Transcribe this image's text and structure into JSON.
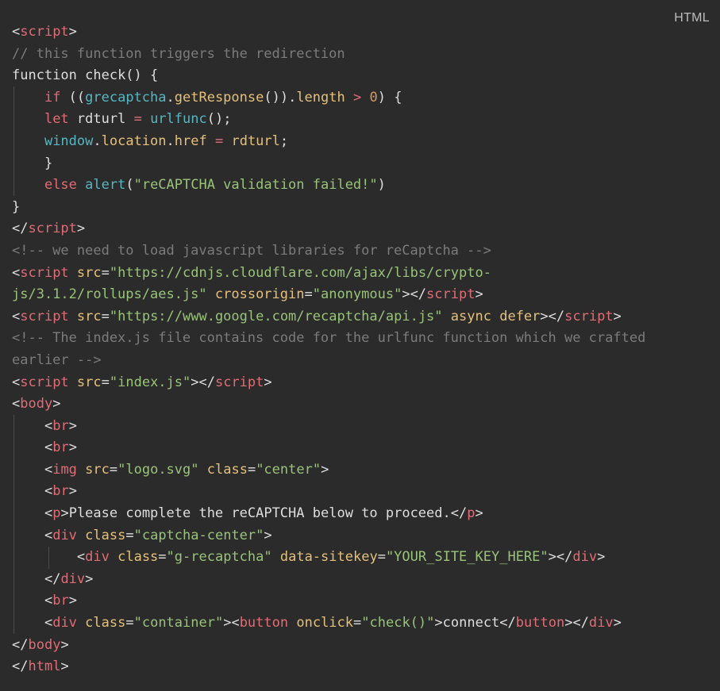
{
  "header": {
    "language_label": "HTML"
  },
  "code_lines": [
    [
      [
        "tag-bracket",
        "<"
      ],
      [
        "tag",
        "script"
      ],
      [
        "tag-bracket",
        ">"
      ]
    ],
    [
      [
        "comment",
        "// this function triggers the redirection"
      ]
    ],
    [
      [
        "plain",
        "function "
      ],
      [
        "plain",
        "check() {"
      ]
    ],
    [
      [
        "plain",
        "    "
      ],
      [
        "kw",
        "if"
      ],
      [
        "plain",
        " (("
      ],
      [
        "builtin",
        "grecaptcha"
      ],
      [
        "plain",
        "."
      ],
      [
        "fn",
        "getResponse"
      ],
      [
        "plain",
        "())."
      ],
      [
        "fn",
        "length"
      ],
      [
        "plain",
        " "
      ],
      [
        "op",
        ">"
      ],
      [
        "plain",
        " "
      ],
      [
        "num",
        "0"
      ],
      [
        "plain",
        ") {"
      ]
    ],
    [
      [
        "plain",
        "    "
      ],
      [
        "kw",
        "let"
      ],
      [
        "plain",
        " rdturl "
      ],
      [
        "op",
        "="
      ],
      [
        "plain",
        " "
      ],
      [
        "builtin",
        "urlfunc"
      ],
      [
        "plain",
        "();"
      ]
    ],
    [
      [
        "plain",
        "    "
      ],
      [
        "builtin",
        "window"
      ],
      [
        "plain",
        "."
      ],
      [
        "fn",
        "location"
      ],
      [
        "plain",
        "."
      ],
      [
        "fn",
        "href"
      ],
      [
        "plain",
        " "
      ],
      [
        "op",
        "="
      ],
      [
        "plain",
        " "
      ],
      [
        "fn",
        "rdturl"
      ],
      [
        "plain",
        ";"
      ]
    ],
    [
      [
        "plain",
        "    }"
      ]
    ],
    [
      [
        "plain",
        "    "
      ],
      [
        "kw",
        "else"
      ],
      [
        "plain",
        " "
      ],
      [
        "builtin",
        "alert"
      ],
      [
        "plain",
        "("
      ],
      [
        "str",
        "\"reCAPTCHA validation failed!\""
      ],
      [
        "plain",
        ")"
      ]
    ],
    [
      [
        "plain",
        "}"
      ]
    ],
    [
      [
        "tag-bracket",
        "</"
      ],
      [
        "tag",
        "script"
      ],
      [
        "tag-bracket",
        ">"
      ]
    ],
    [
      [
        "comment",
        "<!-- we need to load javascript libraries for reCaptcha -->"
      ]
    ],
    [
      [
        "tag-bracket",
        "<"
      ],
      [
        "tag",
        "script"
      ],
      [
        "plain",
        " "
      ],
      [
        "attr",
        "src"
      ],
      [
        "plain",
        "="
      ],
      [
        "str",
        "\"https://cdnjs.cloudflare.com/ajax/libs/crypto-"
      ]
    ],
    [
      [
        "str",
        "js/3.1.2/rollups/aes.js\""
      ],
      [
        "plain",
        " "
      ],
      [
        "attr",
        "crossorigin"
      ],
      [
        "plain",
        "="
      ],
      [
        "str",
        "\"anonymous\""
      ],
      [
        "tag-bracket",
        "></"
      ],
      [
        "tag",
        "script"
      ],
      [
        "tag-bracket",
        ">"
      ]
    ],
    [
      [
        "tag-bracket",
        "<"
      ],
      [
        "tag",
        "script"
      ],
      [
        "plain",
        " "
      ],
      [
        "attr",
        "src"
      ],
      [
        "plain",
        "="
      ],
      [
        "str",
        "\"https://www.google.com/recaptcha/api.js\""
      ],
      [
        "plain",
        " "
      ],
      [
        "attr",
        "async"
      ],
      [
        "plain",
        " "
      ],
      [
        "attr",
        "defer"
      ],
      [
        "tag-bracket",
        "></"
      ],
      [
        "tag",
        "script"
      ],
      [
        "tag-bracket",
        ">"
      ]
    ],
    [
      [
        "comment",
        "<!-- The index.js file contains code for the urlfunc function which we crafted"
      ]
    ],
    [
      [
        "comment",
        "earlier -->"
      ]
    ],
    [
      [
        "tag-bracket",
        "<"
      ],
      [
        "tag",
        "script"
      ],
      [
        "plain",
        " "
      ],
      [
        "attr",
        "src"
      ],
      [
        "plain",
        "="
      ],
      [
        "str",
        "\"index.js\""
      ],
      [
        "tag-bracket",
        "></"
      ],
      [
        "tag",
        "script"
      ],
      [
        "tag-bracket",
        ">"
      ]
    ],
    [
      [
        "tag-bracket",
        "<"
      ],
      [
        "tag",
        "body"
      ],
      [
        "tag-bracket",
        ">"
      ]
    ],
    [
      [
        "plain",
        "    "
      ],
      [
        "tag-bracket",
        "<"
      ],
      [
        "tag",
        "br"
      ],
      [
        "tag-bracket",
        ">"
      ]
    ],
    [
      [
        "plain",
        "    "
      ],
      [
        "tag-bracket",
        "<"
      ],
      [
        "tag",
        "br"
      ],
      [
        "tag-bracket",
        ">"
      ]
    ],
    [
      [
        "plain",
        "    "
      ],
      [
        "tag-bracket",
        "<"
      ],
      [
        "tag",
        "img"
      ],
      [
        "plain",
        " "
      ],
      [
        "attr",
        "src"
      ],
      [
        "plain",
        "="
      ],
      [
        "str",
        "\"logo.svg\""
      ],
      [
        "plain",
        " "
      ],
      [
        "attr",
        "class"
      ],
      [
        "plain",
        "="
      ],
      [
        "str",
        "\"center\""
      ],
      [
        "tag-bracket",
        ">"
      ]
    ],
    [
      [
        "plain",
        "    "
      ],
      [
        "tag-bracket",
        "<"
      ],
      [
        "tag",
        "br"
      ],
      [
        "tag-bracket",
        ">"
      ]
    ],
    [
      [
        "plain",
        "    "
      ],
      [
        "tag-bracket",
        "<"
      ],
      [
        "tag",
        "p"
      ],
      [
        "tag-bracket",
        ">"
      ],
      [
        "plain",
        "Please complete the reCAPTCHA below to proceed."
      ],
      [
        "tag-bracket",
        "</"
      ],
      [
        "tag",
        "p"
      ],
      [
        "tag-bracket",
        ">"
      ]
    ],
    [
      [
        "plain",
        "    "
      ],
      [
        "tag-bracket",
        "<"
      ],
      [
        "tag",
        "div"
      ],
      [
        "plain",
        " "
      ],
      [
        "attr",
        "class"
      ],
      [
        "plain",
        "="
      ],
      [
        "str",
        "\"captcha-center\""
      ],
      [
        "tag-bracket",
        ">"
      ]
    ],
    [
      [
        "plain",
        "        "
      ],
      [
        "tag-bracket",
        "<"
      ],
      [
        "tag",
        "div"
      ],
      [
        "plain",
        " "
      ],
      [
        "attr",
        "class"
      ],
      [
        "plain",
        "="
      ],
      [
        "str",
        "\"g-recaptcha\""
      ],
      [
        "plain",
        " "
      ],
      [
        "attr",
        "data-sitekey"
      ],
      [
        "plain",
        "="
      ],
      [
        "str",
        "\"YOUR_SITE_KEY_HERE\""
      ],
      [
        "tag-bracket",
        "></"
      ],
      [
        "tag",
        "div"
      ],
      [
        "tag-bracket",
        ">"
      ]
    ],
    [
      [
        "plain",
        "    "
      ],
      [
        "tag-bracket",
        "</"
      ],
      [
        "tag",
        "div"
      ],
      [
        "tag-bracket",
        ">"
      ]
    ],
    [
      [
        "plain",
        "    "
      ],
      [
        "tag-bracket",
        "<"
      ],
      [
        "tag",
        "br"
      ],
      [
        "tag-bracket",
        ">"
      ]
    ],
    [
      [
        "plain",
        "    "
      ],
      [
        "tag-bracket",
        "<"
      ],
      [
        "tag",
        "div"
      ],
      [
        "plain",
        " "
      ],
      [
        "attr",
        "class"
      ],
      [
        "plain",
        "="
      ],
      [
        "str",
        "\"container\""
      ],
      [
        "tag-bracket",
        "><"
      ],
      [
        "tag",
        "button"
      ],
      [
        "plain",
        " "
      ],
      [
        "attr",
        "onclick"
      ],
      [
        "plain",
        "="
      ],
      [
        "str",
        "\"check()\""
      ],
      [
        "tag-bracket",
        ">"
      ],
      [
        "plain",
        "connect"
      ],
      [
        "tag-bracket",
        "</"
      ],
      [
        "tag",
        "button"
      ],
      [
        "tag-bracket",
        "></"
      ],
      [
        "tag",
        "div"
      ],
      [
        "tag-bracket",
        ">"
      ]
    ],
    [
      [
        "tag-bracket",
        "</"
      ],
      [
        "tag",
        "body"
      ],
      [
        "tag-bracket",
        ">"
      ]
    ],
    [
      [
        "tag-bracket",
        "</"
      ],
      [
        "tag",
        "html"
      ],
      [
        "tag-bracket",
        ">"
      ]
    ]
  ],
  "colors": {
    "background": "#2b2b2b",
    "plain": "#dedede",
    "tag": "#e06c75",
    "attribute": "#e5c07b",
    "string": "#98c379",
    "comment": "#7b7b7b",
    "builtin": "#56b6c2",
    "number": "#d19a66"
  }
}
